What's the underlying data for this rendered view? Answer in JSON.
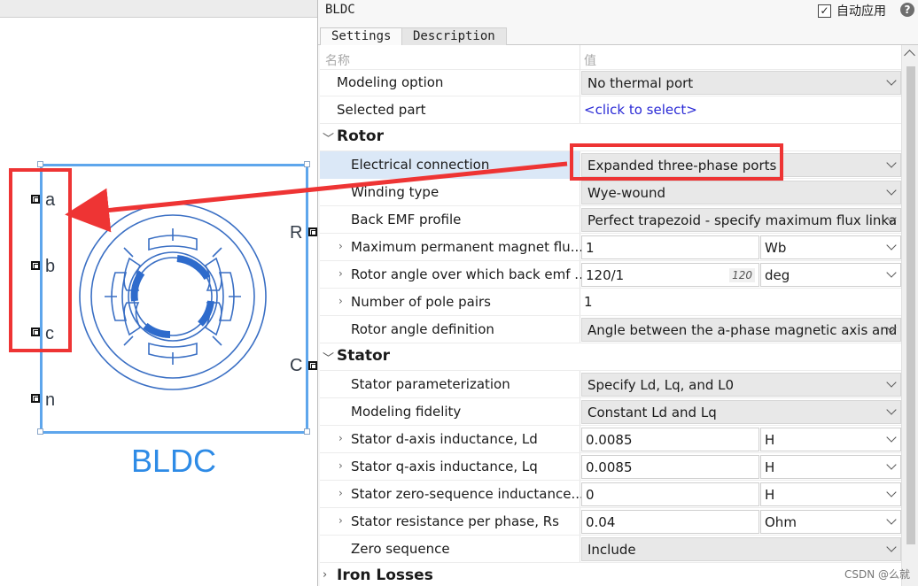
{
  "canvas": {
    "block_name": "BLDC",
    "ports_left": [
      "a",
      "b",
      "c",
      "n"
    ],
    "ports_right": [
      "R",
      "C"
    ]
  },
  "panel": {
    "title": "BLDC",
    "auto_apply_label": "自动应用",
    "auto_apply_checked": true,
    "help_icon": "question-icon",
    "tabs": [
      "Settings",
      "Description"
    ],
    "header": {
      "name_col": "名称",
      "value_col": "值"
    },
    "rows": {
      "modeling_option": {
        "label": "Modeling option",
        "value": "No thermal port"
      },
      "selected_part": {
        "label": "Selected part",
        "value": "<click to select>"
      },
      "rotor": {
        "label": "Rotor"
      },
      "electrical_connection": {
        "label": "Electrical connection",
        "value": "Expanded three-phase ports"
      },
      "winding_type": {
        "label": "Winding type",
        "value": "Wye-wound"
      },
      "back_emf_profile": {
        "label": "Back EMF profile",
        "value": "Perfect trapezoid - specify maximum flux linka"
      },
      "max_pm_flux": {
        "label": "Maximum permanent magnet flu...",
        "value": "1",
        "unit": "Wb"
      },
      "rotor_angle_back_emf": {
        "label": "Rotor angle over which back emf ...",
        "value": "120/1",
        "hint": "120",
        "unit": "deg"
      },
      "pole_pairs": {
        "label": "Number of pole pairs",
        "value": "1"
      },
      "rotor_angle_def": {
        "label": "Rotor angle definition",
        "value": "Angle between the a-phase magnetic axis and"
      },
      "stator": {
        "label": "Stator"
      },
      "stator_param": {
        "label": "Stator parameterization",
        "value": "Specify Ld, Lq, and L0"
      },
      "modeling_fidelity": {
        "label": "Modeling fidelity",
        "value": "Constant Ld and Lq"
      },
      "ld": {
        "label": "Stator d-axis inductance, Ld",
        "value": "0.0085",
        "unit": "H"
      },
      "lq": {
        "label": "Stator q-axis inductance, Lq",
        "value": "0.0085",
        "unit": "H"
      },
      "l0": {
        "label": "Stator zero-sequence inductance...",
        "value": "0",
        "unit": "H"
      },
      "rs": {
        "label": "Stator resistance per phase, Rs",
        "value": "0.04",
        "unit": "Ohm"
      },
      "zero_seq": {
        "label": "Zero sequence",
        "value": "Include"
      },
      "iron_losses": {
        "label": "Iron Losses"
      }
    }
  },
  "watermark": "CSDN @么就",
  "colors": {
    "highlight": "#ee3434",
    "block_border": "#5ea6ec",
    "block_title": "#2e8be6",
    "link": "#2a2ad6"
  }
}
